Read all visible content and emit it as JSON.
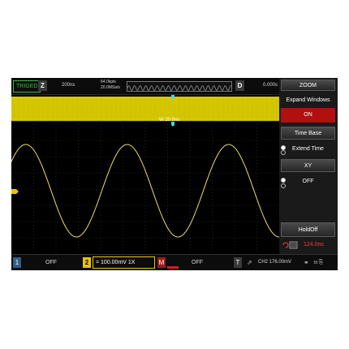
{
  "top_bar": {
    "trigger_status": "TRIGED",
    "zoom_label": "Z",
    "timebase": "200ns",
    "sample_depth": "64.0kpts",
    "sample_rate": "20.0MSa/s",
    "delay_label": "D",
    "delay_value": "0.000s"
  },
  "plot": {
    "window_label": "W 20.0ns",
    "channel_marker": "2"
  },
  "side_menu": {
    "title": "ZOOM",
    "expand_windows_label": "Expand Windows",
    "expand_windows_value": "ON",
    "time_base_label": "Time Base",
    "time_base_option": "Extend Time",
    "xy_label": "XY",
    "xy_option": "OFF",
    "holdoff_label": "HoldOff",
    "holdoff_value": "124.0ns"
  },
  "bottom_bar": {
    "ch1_label": "1",
    "ch1_state": "OFF",
    "ch2_label": "2",
    "ch2_setting": "= 100.00mV  1X",
    "math_label": "M",
    "math_state": "OFF",
    "trigger_label": "T",
    "trigger_info": "CH2 176.00mV"
  },
  "colors": {
    "ch2": "#e7c211",
    "ch1": "#2d5f8a",
    "accent_red": "#b01010",
    "trace": "#e8dc6a"
  },
  "icons": [
    "usb-icon",
    "ethernet-icon",
    "connection-icon",
    "printer-icon"
  ]
}
